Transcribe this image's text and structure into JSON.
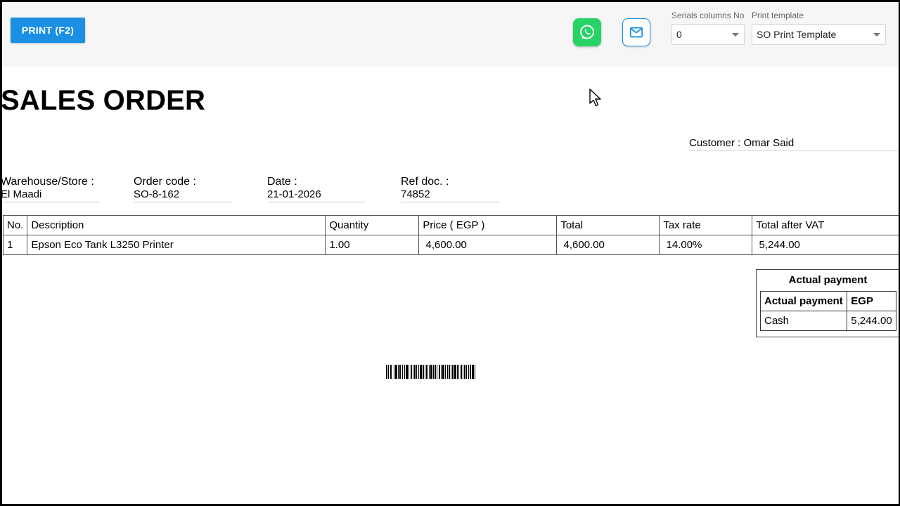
{
  "toolbar": {
    "print_label": "PRINT (F2)",
    "serials_label": "Serials columns No",
    "serials_value": "0",
    "template_label": "Print template",
    "template_value": "SO Print Template",
    "whatsapp_icon": "whatsapp-icon",
    "mail_icon": "mail-icon"
  },
  "document": {
    "title": "SALES ORDER",
    "customer": "Customer : Omar Said",
    "info": [
      {
        "label": "Warehouse/Store :",
        "value": "El Maadi"
      },
      {
        "label": "Order code :",
        "value": "SO-8-162"
      },
      {
        "label": "Date :",
        "value": "21-01-2026"
      },
      {
        "label": "Ref doc. :",
        "value": "74852"
      }
    ],
    "table": {
      "headers": [
        "No.",
        "Description",
        "Quantity",
        "Price ( EGP )",
        "Total",
        "Tax rate",
        "Total after VAT"
      ],
      "rows": [
        [
          "1",
          "Epson Eco Tank L3250 Printer",
          "1.00",
          " 4,600.00",
          " 4,600.00",
          " 14.00%",
          " 5,244.00"
        ]
      ]
    },
    "payment": {
      "title": "Actual payment",
      "headers": [
        "Actual payment",
        "EGP"
      ],
      "rows": [
        [
          "Cash",
          "5,244.00"
        ]
      ]
    }
  },
  "colors": {
    "print_button": "#1a8fe3",
    "whatsapp": "#25d366",
    "toolbar_bg": "#f6f6f6"
  }
}
